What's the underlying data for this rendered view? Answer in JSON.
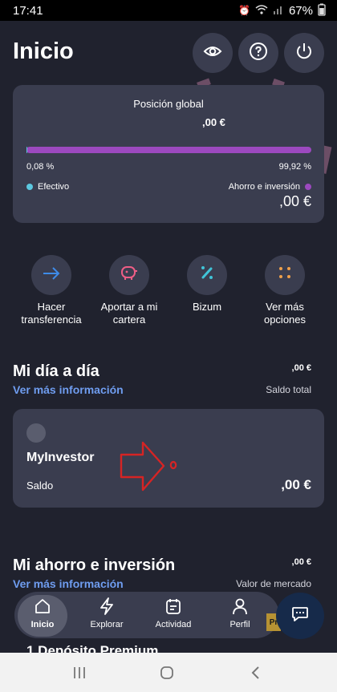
{
  "status_bar": {
    "time": "17:41",
    "battery": "67%"
  },
  "header": {
    "title": "Inicio"
  },
  "global_position": {
    "title": "Posición global",
    "amount": ",00 €",
    "cash_percent_label": "0,08 %",
    "invest_percent_label": "99,92 %",
    "cash_fraction": 0.0008,
    "cash_label": "Efectivo",
    "invest_label": "Ahorro e inversión",
    "invest_amount": ",00 €",
    "colors": {
      "cash": "#5cc8e0",
      "invest": "#9c49bf"
    }
  },
  "quick_actions": [
    {
      "label": "Hacer transferencia",
      "icon": "arrow-right-icon"
    },
    {
      "label": "Aportar a mi cartera",
      "icon": "piggy-bank-icon"
    },
    {
      "label": "Bizum",
      "icon": "bizum-icon"
    },
    {
      "label": "Ver más opciones",
      "icon": "grid-dots-icon"
    }
  ],
  "day_to_day": {
    "title": "Mi día a día",
    "link": "Ver más información",
    "amount": ",00 €",
    "amount_label": "Saldo total"
  },
  "account_card": {
    "name": "MyInvestor",
    "balance_label": "Saldo",
    "balance": ",00 €"
  },
  "savings": {
    "title": "Mi ahorro e inversión",
    "link": "Ver más información",
    "amount": ",00 €",
    "amount_label": "Valor de mercado"
  },
  "deposit_title": "1 Depósito Premium",
  "premium_badge": "Pr",
  "bottom_nav": [
    {
      "label": "Inicio",
      "icon": "home-icon"
    },
    {
      "label": "Explorar",
      "icon": "lightning-icon"
    },
    {
      "label": "Actividad",
      "icon": "calendar-icon"
    },
    {
      "label": "Perfil",
      "icon": "user-icon"
    }
  ]
}
